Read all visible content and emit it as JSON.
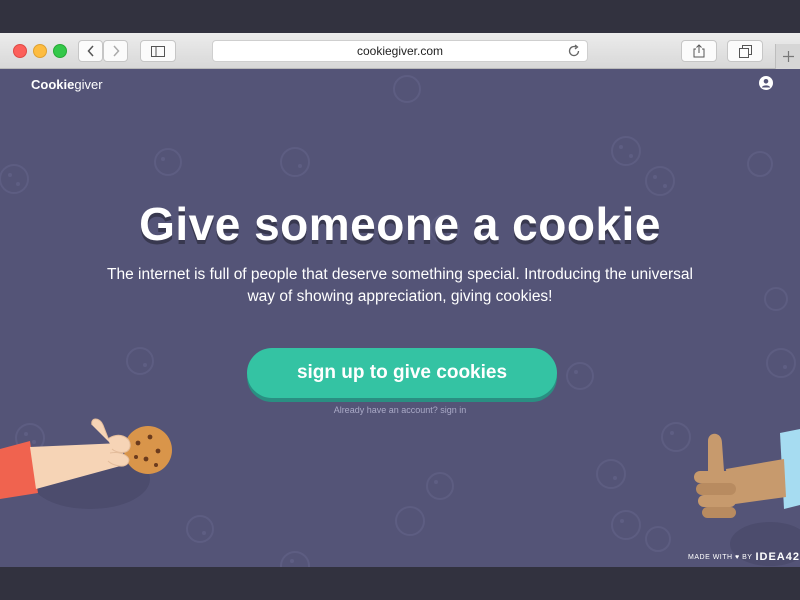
{
  "browser": {
    "url": "cookiegiver.com"
  },
  "header": {
    "logo_bold": "Cookie",
    "logo_rest": "giver"
  },
  "hero": {
    "headline": "Give someone a cookie",
    "subtitle": "The internet is full of people that deserve something special. Introducing the universal way of showing appreciation, giving cookies!",
    "cta_label": "sign up to give cookies",
    "signin_prefix": "Already have an account?",
    "signin_link": "sign in"
  },
  "footer": {
    "made_with": "MADE WITH ♥ BY",
    "brand": "IDEA42"
  },
  "colors": {
    "background": "#545477",
    "cta": "#34c3a3",
    "cookie": "#d9954a"
  }
}
